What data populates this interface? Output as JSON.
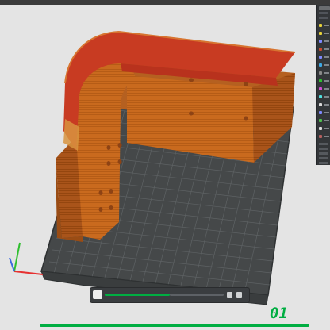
{
  "colors": {
    "plate": "#454849",
    "grid": "#5e6264",
    "model_orange": "#c96a1e",
    "model_top_red": "#c83b22",
    "accent": "#00ae42",
    "axis_x": "#e63030",
    "axis_y": "#2fbf2f",
    "axis_z": "#3f6be0"
  },
  "icons": [
    "axis-gizmo-icon",
    "layer-slider-icon",
    "legend-color-swatches"
  ],
  "layer_slider": {
    "current_layer": "01"
  },
  "legend_swatches": [
    "#e8d23a",
    "#e8d23a",
    "#7e89ff",
    "#c94a2f",
    "#7e89ff",
    "#3ea9e6",
    "#8a8a8a",
    "#2fbf2f",
    "#d24fd2",
    "#4fe0e0",
    "#d9d9d9",
    "#7e89ff",
    "#4fc04f",
    "#dddddd",
    "#b45f5f"
  ]
}
